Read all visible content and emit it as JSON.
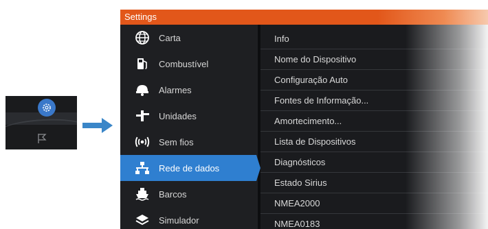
{
  "window": {
    "title": "Settings"
  },
  "sidebar": {
    "items": [
      {
        "label": "Carta",
        "icon": "globe-icon",
        "active": false
      },
      {
        "label": "Combustível",
        "icon": "fuel-pump-icon",
        "active": false
      },
      {
        "label": "Alarmes",
        "icon": "alarm-bell-icon",
        "active": false
      },
      {
        "label": "Unidades",
        "icon": "units-icon",
        "active": false
      },
      {
        "label": "Sem fios",
        "icon": "wireless-icon",
        "active": false
      },
      {
        "label": "Rede de dados",
        "icon": "network-icon",
        "active": true
      },
      {
        "label": "Barcos",
        "icon": "ship-icon",
        "active": false
      },
      {
        "label": "Simulador",
        "icon": "layers-icon",
        "active": false
      }
    ]
  },
  "submenu": {
    "items": [
      "Info",
      "Nome do Dispositivo",
      "Configuração Auto",
      "Fontes de Informação...",
      "Amortecimento...",
      "Lista de Dispositivos",
      "Diagnósticos",
      "Estado Sirius",
      "NMEA2000",
      "NMEA0183"
    ]
  },
  "colors": {
    "title_bar": "#e2571a",
    "active_item": "#2f7fd0",
    "panel_bg": "#1a1b1e"
  }
}
